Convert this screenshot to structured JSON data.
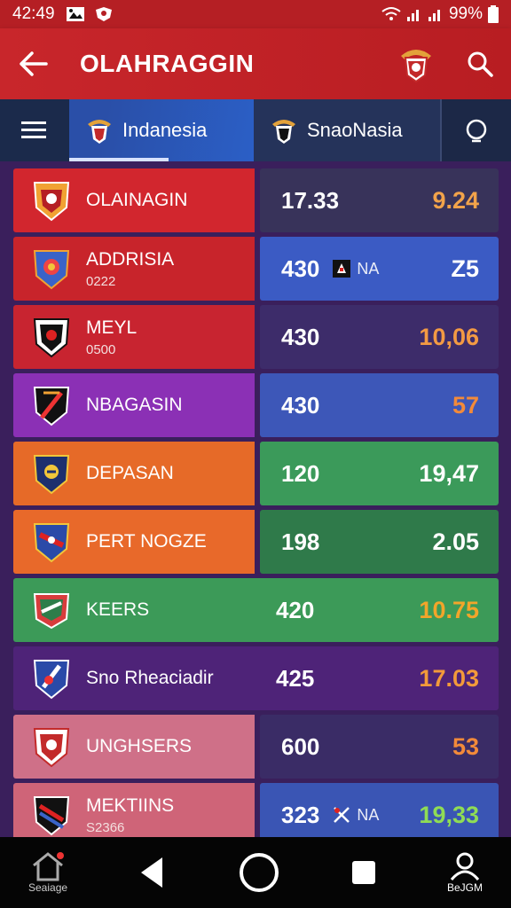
{
  "status": {
    "time": "42:49",
    "battery": "99%"
  },
  "app": {
    "title": "OLAHRAGGIN"
  },
  "tabs": [
    {
      "label": "Indanesia"
    },
    {
      "label": "SnaoNasia"
    }
  ],
  "colors": {
    "app_bar": "#c8262b",
    "tab_active": "#2b5fc6",
    "highlight_orange": "#f2a03a",
    "highlight_green": "#8fdc55"
  },
  "rows": [
    {
      "name": "OLAINAGIN",
      "sub": "",
      "v1": "17.33",
      "mid": "",
      "v2": "9.24",
      "v2_color": "#f2a34a"
    },
    {
      "name": "ADDRISIA",
      "sub": "0222",
      "v1": "430",
      "mid": "NA",
      "v2": "Z5",
      "v2_color": "#ffffff"
    },
    {
      "name": "MEYL",
      "sub": "0500",
      "v1": "430",
      "mid": "",
      "v2": "10,06",
      "v2_color": "#f39a43"
    },
    {
      "name": "NBAGASIN",
      "sub": "",
      "v1": "430",
      "mid": "",
      "v2": "57",
      "v2_color": "#f28a3a"
    },
    {
      "name": "DEPASAN",
      "sub": "",
      "v1": "120",
      "mid": "",
      "v2": "19,47",
      "v2_color": "#ffffff"
    },
    {
      "name": "PERT NOGZE",
      "sub": "",
      "v1": "198",
      "mid": "",
      "v2": "2.05",
      "v2_color": "#ffffff"
    },
    {
      "name": "KEERS",
      "sub": "",
      "v1": "420",
      "mid": "",
      "v2": "10.75",
      "v2_color": "#f2a52a"
    },
    {
      "name": "Sno Rheaciadir",
      "sub": "",
      "v1": "425",
      "mid": "",
      "v2": "17.03",
      "v2_color": "#f39a3a"
    },
    {
      "name": "UNGHSERS",
      "sub": "",
      "v1": "600",
      "mid": "",
      "v2": "53",
      "v2_color": "#f28a3a"
    },
    {
      "name": "MEKTIINS",
      "sub": "S2366",
      "v1": "323",
      "mid": "NA",
      "v2": "19,33",
      "v2_color": "#8fdc55"
    }
  ],
  "nav": {
    "home_label": "Seaiage",
    "profile_label": "BeJGM"
  }
}
